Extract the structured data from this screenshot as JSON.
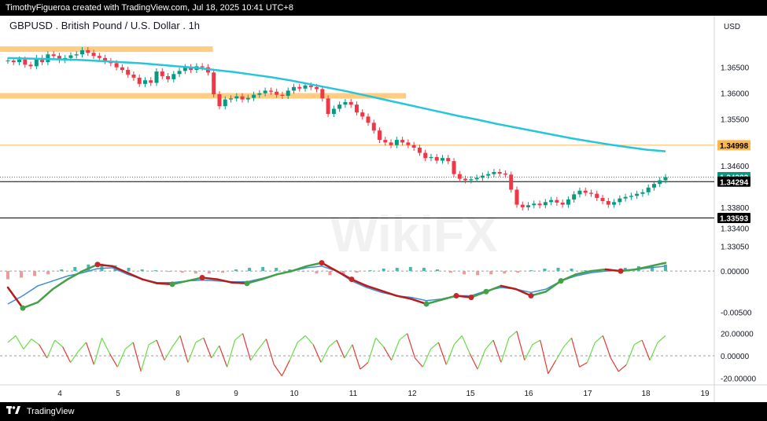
{
  "header": {
    "attribution": "TimothyFigueroa created with TradingView.com, Jul 18, 2025 10:41 UTC+8"
  },
  "footer": {
    "brand": "TradingView"
  },
  "watermark": "WikiFX",
  "chart_data": {
    "type": "candlestick",
    "title": "GBPUSD . British Pound / U.S. Dollar . 1h",
    "currency": "USD",
    "x_ticks": [
      "4",
      "5",
      "8",
      "9",
      "10",
      "11",
      "12",
      "15",
      "16",
      "17",
      "18",
      "19"
    ],
    "price_axis": {
      "ticks": [
        "1.36500",
        "1.36000",
        "1.35500",
        "1.34600",
        "1.33800",
        "1.33400",
        "1.33050"
      ],
      "ylim": [
        1.3295,
        1.3695
      ]
    },
    "price_labels": [
      {
        "value": 1.34998,
        "label": "1.34998",
        "color": "#ffb74d",
        "text": "#000000"
      },
      {
        "value": 1.34382,
        "label": "1.34382",
        "color": "#089981",
        "text": "#ffffff"
      },
      {
        "value": 1.34294,
        "label": "1.34294",
        "color": "#000000",
        "text": "#ffffff"
      },
      {
        "value": 1.33593,
        "label": "1.33593",
        "color": "#000000",
        "text": "#ffffff"
      }
    ],
    "horizontal_lines": [
      {
        "value": 1.34998,
        "color": "#ffb74d"
      },
      {
        "value": 1.34294,
        "color": "#000000"
      },
      {
        "value": 1.33593,
        "color": "#000000"
      }
    ],
    "zones": [
      {
        "from_tick": 0,
        "to_tick": 35,
        "price": 1.3685,
        "color": "#ffcc80"
      },
      {
        "from_tick": 0,
        "to_tick": 68,
        "price": 1.3595,
        "color": "#ffcc80"
      }
    ],
    "price_series": [
      1.3663,
      1.366,
      1.3665,
      1.3655,
      1.3652,
      1.3668,
      1.366,
      1.3675,
      1.3672,
      1.3664,
      1.3668,
      1.3673,
      1.3675,
      1.3683,
      1.3678,
      1.3672,
      1.3668,
      1.3662,
      1.3658,
      1.365,
      1.3645,
      1.3636,
      1.363,
      1.3618,
      1.3625,
      1.362,
      1.3642,
      1.3633,
      1.3627,
      1.3637,
      1.3643,
      1.365,
      1.3645,
      1.3652,
      1.365,
      1.364,
      1.3598,
      1.3575,
      1.3588,
      1.359,
      1.3594,
      1.3588,
      1.3591,
      1.3597,
      1.36,
      1.3605,
      1.3603,
      1.3597,
      1.3595,
      1.3605,
      1.3612,
      1.3609,
      1.3615,
      1.3612,
      1.3608,
      1.359,
      1.356,
      1.357,
      1.3578,
      1.3583,
      1.3578,
      1.3563,
      1.3555,
      1.3543,
      1.3528,
      1.351,
      1.3505,
      1.35,
      1.351,
      1.3505,
      1.35,
      1.3495,
      1.3485,
      1.3475,
      1.3477,
      1.347,
      1.3475,
      1.3469,
      1.3444,
      1.3435,
      1.3432,
      1.3434,
      1.3437,
      1.3441,
      1.3444,
      1.3448,
      1.3445,
      1.3443,
      1.3414,
      1.3385,
      1.338,
      1.3384,
      1.3387,
      1.3384,
      1.339,
      1.3394,
      1.3389,
      1.3385,
      1.3395,
      1.3405,
      1.3412,
      1.3408,
      1.3406,
      1.3398,
      1.3392,
      1.3385,
      1.339,
      1.3397,
      1.34,
      1.3402,
      1.3406,
      1.3409,
      1.3418,
      1.3425,
      1.3432,
      1.3438
    ],
    "moving_average": [
      1.3668,
      1.3667,
      1.3666,
      1.3665,
      1.3664,
      1.3662,
      1.366,
      1.3658,
      1.3655,
      1.3652,
      1.3649,
      1.3645,
      1.3641,
      1.3636,
      1.3631,
      1.3625,
      1.3618,
      1.3611,
      1.3604,
      1.3596,
      1.3588,
      1.358,
      1.3572,
      1.3564,
      1.3556,
      1.3549,
      1.3541,
      1.3534,
      1.3527,
      1.352,
      1.3513,
      1.3507,
      1.3501,
      1.3496,
      1.3491,
      1.3488
    ],
    "oscillator": {
      "axis_ticks": [
        "0.00000",
        "-0.00500"
      ],
      "ylim": [
        -0.0062,
        0.0024
      ],
      "histogram": [
        -0.001,
        -0.0008,
        -0.0006,
        -0.0004,
        0.0002,
        0.0005,
        0.0008,
        0.0009,
        0.0007,
        0.0004,
        0.0002,
        0.0001,
        -0.0001,
        -0.0002,
        -0.0003,
        -0.0003,
        -0.0002,
        0.0002,
        0.0004,
        0.0005,
        0.0004,
        0.0002,
        -0.0001,
        -0.0003,
        -0.0005,
        -0.0004,
        -0.0002,
        0.0001,
        0.0003,
        0.0004,
        0.0005,
        0.0004,
        0.0002,
        -0.0002,
        -0.0004,
        -0.0005,
        -0.0004,
        -0.0003,
        -0.0002,
        0.0001,
        0.0003,
        0.0004,
        0.0003,
        0.0001,
        -0.0001,
        0.0002,
        0.0004,
        0.0006,
        0.0007,
        0.0008
      ],
      "macd": [
        -0.002,
        -0.0045,
        -0.0038,
        -0.0022,
        -0.001,
        0.0,
        0.0008,
        0.0006,
        -0.0002,
        -0.001,
        -0.0015,
        -0.0016,
        -0.0012,
        -0.0008,
        -0.001,
        -0.0014,
        -0.0015,
        -0.001,
        -0.0004,
        0.0,
        0.0006,
        0.001,
        0.0,
        -0.001,
        -0.0018,
        -0.0024,
        -0.003,
        -0.0034,
        -0.004,
        -0.0035,
        -0.003,
        -0.0032,
        -0.0025,
        -0.0018,
        -0.0022,
        -0.003,
        -0.0025,
        -0.0012,
        -0.0004,
        0.0,
        0.0002,
        0.0,
        0.0002,
        0.0006,
        0.001
      ],
      "signal": [
        -0.004,
        -0.003,
        -0.0018,
        -0.0012,
        -0.0006,
        -0.0002,
        0.0003,
        0.0004,
        -0.0004,
        -0.001,
        -0.0014,
        -0.0014,
        -0.0012,
        -0.0011,
        -0.0012,
        -0.0013,
        -0.0013,
        -0.0009,
        -0.0004,
        0.0,
        0.0004,
        0.0006,
        0.0,
        -0.0012,
        -0.002,
        -0.0026,
        -0.003,
        -0.0032,
        -0.0036,
        -0.0034,
        -0.003,
        -0.003,
        -0.0024,
        -0.002,
        -0.0022,
        -0.0026,
        -0.0022,
        -0.0012,
        -0.0006,
        -0.0002,
        0.0,
        0.0001,
        0.0002,
        0.0004,
        0.0006
      ],
      "cross_points": [
        {
          "index": 1,
          "color": "#43a047"
        },
        {
          "index": 6,
          "color": "#c62828"
        },
        {
          "index": 11,
          "color": "#43a047"
        },
        {
          "index": 13,
          "color": "#c62828"
        },
        {
          "index": 16,
          "color": "#43a047"
        },
        {
          "index": 21,
          "color": "#c62828"
        },
        {
          "index": 23,
          "color": "#c62828"
        },
        {
          "index": 28,
          "color": "#43a047"
        },
        {
          "index": 30,
          "color": "#c62828"
        },
        {
          "index": 31,
          "color": "#c62828"
        },
        {
          "index": 32,
          "color": "#43a047"
        },
        {
          "index": 35,
          "color": "#c62828"
        },
        {
          "index": 37,
          "color": "#43a047"
        },
        {
          "index": 41,
          "color": "#c62828"
        }
      ]
    },
    "momentum": {
      "axis_ticks": [
        "20.00000",
        "0.00000",
        "-20.00000"
      ],
      "ylim": [
        -26,
        26
      ],
      "values": [
        12,
        18,
        6,
        15,
        10,
        -2,
        14,
        8,
        -6,
        4,
        12,
        -8,
        16,
        2,
        -10,
        6,
        12,
        -14,
        10,
        14,
        -4,
        8,
        18,
        -6,
        12,
        16,
        -2,
        9,
        -10,
        14,
        20,
        -4,
        6,
        15,
        -8,
        -18,
        -4,
        12,
        18,
        10,
        -6,
        8,
        14,
        -2,
        10,
        -12,
        -6,
        16,
        8,
        -4,
        14,
        20,
        -2,
        -10,
        6,
        12,
        -8,
        10,
        18,
        2,
        -12,
        6,
        14,
        -6,
        16,
        22,
        -4,
        10,
        14,
        -16,
        -4,
        8,
        16,
        -10,
        -6,
        12,
        18,
        -2,
        -14,
        -8,
        10,
        14,
        -4,
        12,
        18
      ]
    }
  },
  "colors": {
    "up_candle": "#089981",
    "down_candle": "#f23645",
    "moving_average": "#26c6da",
    "macd_line": "#3f8fd6",
    "macd_up": "#43a047",
    "macd_down": "#b71c1c",
    "momentum_up": "#66dd44",
    "momentum_down": "#e53935"
  }
}
